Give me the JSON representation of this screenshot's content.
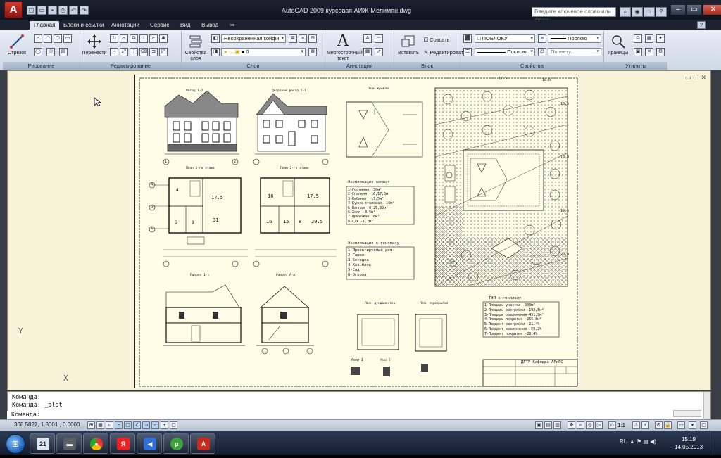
{
  "app": {
    "logo": "A",
    "title": "AutoCAD 2009  курсовая АИЖ-Мелимян.dwg",
    "search_placeholder": "Введите ключевое слово или фразу",
    "qat_icons": [
      "new-icon",
      "open-icon",
      "save-icon",
      "print-icon",
      "undo-icon",
      "redo-icon"
    ]
  },
  "ribbon": {
    "tabs": [
      "Главная",
      "Блоки и ссылки",
      "Аннотации",
      "Сервис",
      "Вид",
      "Вывод"
    ],
    "active_tab": "Главная",
    "panels": {
      "draw": {
        "title": "Рисование",
        "line_label": "Отрезок"
      },
      "modify": {
        "title": "Редактирование",
        "move_label": "Перенести"
      },
      "layers": {
        "title": "Слои",
        "properties_label": "Свойства слоя",
        "layer_state": "Несохраненная конфи",
        "current_layer": "0"
      },
      "annotation": {
        "title": "Аннотация",
        "mtext_label": "Многострочный текст"
      },
      "block": {
        "title": "Блок",
        "insert_label": "Вставить",
        "create_label": "Создать",
        "edit_label": "Редактировать"
      },
      "properties": {
        "title": "Свойства",
        "color": "ПОБЛОКУ",
        "lineweight": "Послою",
        "linetype": "Послою",
        "plotstyle": "Поцвету"
      },
      "utilities": {
        "title": "Утилиты",
        "bounds_label": "Границы"
      }
    }
  },
  "drawing": {
    "labels": {
      "facade_12": "Фасад 1-2",
      "facade_21": "Дворовой фасад 2-1",
      "plan_roof": "План кровли",
      "plan_1": "План 1-го этажа",
      "plan_2": "План 2-го этажа",
      "section_11": "Разрез 1-1",
      "section_aa": "Разрез А-А",
      "plan_found": "План фундаментов",
      "plan_roof2": "План перекрытия",
      "nodes": "Узел 1",
      "node2": "Узел 2"
    },
    "explication_title": "Экспликация комнат",
    "explication": [
      "1-Гостиная     -30м²",
      "2-Спальня     -16,17,5м",
      "3-Кабинет      -17,5м²",
      "4-Кухня-столовая -16м²",
      "5-Ванная      -8,25,32м²",
      "6-Холл        -8,5м²",
      "7-Прихожая    -6м²",
      "8-С/У          -1,2м²"
    ],
    "genplan_title": "Экспликация к генплану",
    "genplan": [
      "1-Проектируемый дом",
      "2-Гараж",
      "3-Беседка",
      "4-Хоз.блок",
      "5-Сад",
      "6-Огород"
    ],
    "tep_title": "ТЭП к генплану",
    "tep": [
      "1-Площадь участка    -900м²",
      "2-Площадь застройки -192,5м²",
      "3-Площадь озеленения-451,9м²",
      "4-Площадь покрытия -255,8м²",
      "5-Процент застройки -21,4%",
      "6-Процент озеленения -50,2%",
      "7-Процент покрытия  -28,4%"
    ],
    "stamp": "ДГТУ  Кафедра АРиГС",
    "dims": [
      "17.5",
      "18.0",
      "18.5",
      "19.0",
      "19.5",
      "20.0"
    ],
    "plan_rooms_1": [
      "17.5",
      "31",
      "4",
      "6",
      "8"
    ],
    "plan_rooms_2": [
      "16",
      "17.5",
      "16",
      "15",
      "8",
      "29.5"
    ],
    "axes_letters": [
      "В",
      "Б",
      "А"
    ],
    "axes_nums": [
      "1",
      "2"
    ]
  },
  "command": {
    "history": [
      "Команда:",
      "Команда:  _plot"
    ],
    "prompt": "Команда:"
  },
  "status": {
    "coords": "368.5827, 1.8001 , 0.0000",
    "scale": "1:1"
  },
  "taskbar": {
    "apps": [
      "calendar",
      "explorer",
      "chrome",
      "yandex",
      "audio",
      "utorrent",
      "autocad"
    ],
    "lang": "RU",
    "time": "15:19",
    "date": "14.05.2013"
  }
}
